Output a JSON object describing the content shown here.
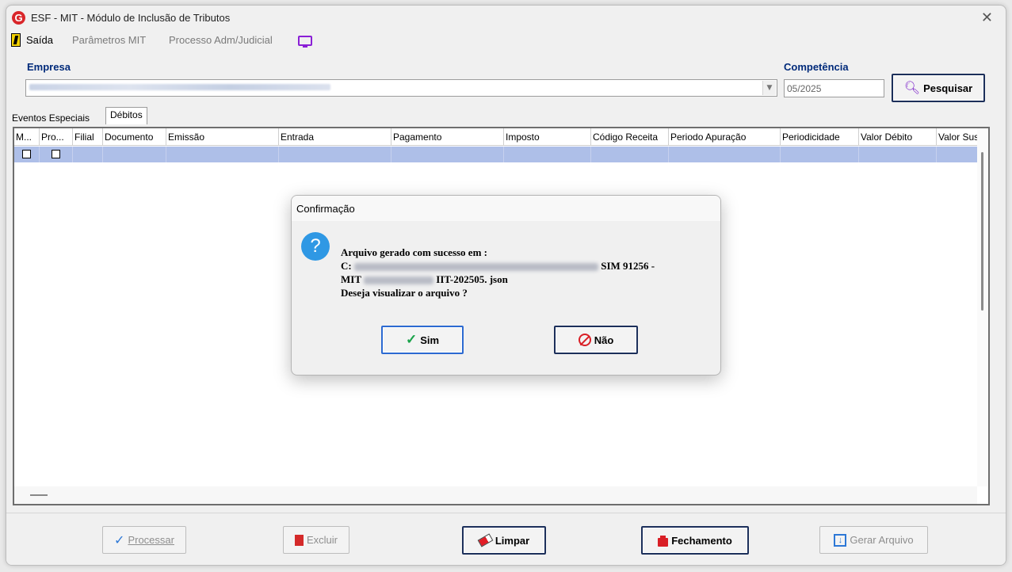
{
  "window": {
    "title": "ESF - MIT - Módulo de Inclusão de Tributos",
    "logo_letter": "G"
  },
  "menu": {
    "exit": "Saída",
    "params": "Parâmetros MIT",
    "process": "Processo Adm/Judicial"
  },
  "filters": {
    "company_label": "Empresa",
    "competence_label": "Competência",
    "competence_value": "05/2025",
    "search_button": "Pesquisar"
  },
  "tabs": [
    "Eventos Especiais",
    "Débitos"
  ],
  "grid": {
    "columns": [
      "M...",
      "Pro...",
      "Filial",
      "Documento",
      "Emissão",
      "Entrada",
      "Pagamento",
      "Imposto",
      "Código Receita",
      "Periodo Apuração",
      "Periodicidade",
      "Valor Débito",
      "Valor Sus"
    ]
  },
  "actions": {
    "processar": "Processar",
    "excluir": "Excluir",
    "limpar": "Limpar",
    "fechamento": "Fechamento",
    "gerar": "Gerar Arquivo"
  },
  "dialog": {
    "title": "Confirmação",
    "line1": "Arquivo gerado com sucesso em :",
    "line2_prefix": "C:",
    "line2_suffix": "SIM 91256 -",
    "line3_prefix": "MIT",
    "line3_suffix": "IIT-202505. json",
    "line4": "Deseja visualizar o arquivo ?",
    "yes": "Sim",
    "no": "Não"
  },
  "colors": {
    "accent": "#002a7a",
    "selection": "#aebfe8",
    "danger": "#d91f26",
    "ok": "#1aa34a"
  }
}
